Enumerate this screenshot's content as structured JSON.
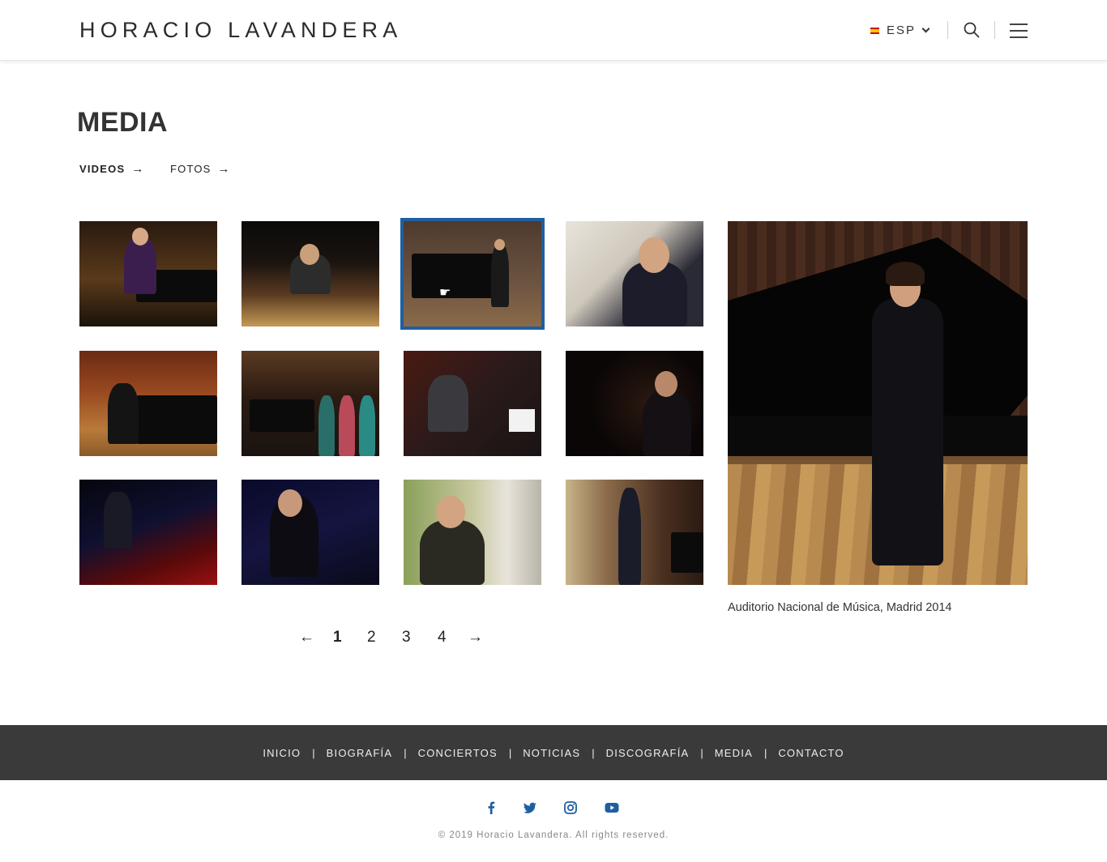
{
  "header": {
    "logo": "HORACIO LAVANDERA",
    "language": "ESP"
  },
  "page": {
    "title": "MEDIA",
    "tabs": [
      {
        "label": "VIDEOS",
        "arrow": "→"
      },
      {
        "label": "FOTOS",
        "arrow": "→"
      }
    ]
  },
  "preview": {
    "caption": "Auditorio Nacional de Música,  Madrid 2014"
  },
  "pagination": {
    "prev": "←",
    "pages": [
      "1",
      "2",
      "3",
      "4"
    ],
    "next": "→"
  },
  "footer": {
    "nav": [
      "INICIO",
      "BIOGRAFÍA",
      "CONCIERTOS",
      "NOTICIAS",
      "DISCOGRAFÍA",
      "MEDIA",
      "CONTACTO"
    ],
    "separator": "|",
    "social": [
      "facebook-icon",
      "twitter-icon",
      "instagram-icon",
      "youtube-icon"
    ],
    "copyright": "© 2019 Horacio Lavandera. All rights reserved."
  },
  "colors": {
    "selected_outline": "#1f5fa0",
    "social_icon": "#1f5fa0",
    "footer_bg": "#3a3a3a"
  }
}
